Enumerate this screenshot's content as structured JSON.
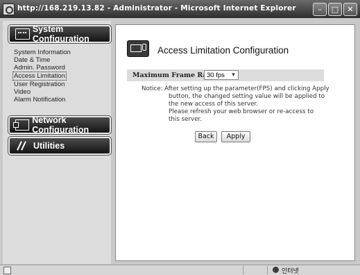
{
  "window": {
    "title": "http://168.219.13.82 - Administrator - Microsoft Internet Explorer",
    "controls": [
      "minimize",
      "restore",
      "close"
    ]
  },
  "nav": {
    "system_configuration": "System Configuration",
    "network_configuration": "Network Configuration",
    "utilities": "Utilities",
    "system_links": [
      "System Information",
      "Date & Time",
      "Admin. Password",
      "Access Limitation",
      "User Registration",
      "Video",
      "Alarm Notification"
    ],
    "active_link": "Access Limitation"
  },
  "content": {
    "title": "Access Limitation Configuration",
    "field_label": "Maximum Frame Rate",
    "frame_rate_value": "30 fps",
    "notice_label": "Notice:",
    "notice_lines": [
      "After setting up the parameter(FPS) and clicking Apply",
      "button, the changed setting value will be applied to",
      "the new access of this server.",
      "Please refresh your web browser or re-access to",
      "this server."
    ],
    "back_label": "Back",
    "apply_label": "Apply"
  },
  "statusbar": {
    "zone": "인터넷"
  },
  "icons": {
    "system": "monitor-wrench-icon",
    "network": "network-icon",
    "utilities": "tools-icon",
    "header": "monitor-wrench-icon",
    "browser": "ie-icon",
    "zone": "globe-icon"
  }
}
